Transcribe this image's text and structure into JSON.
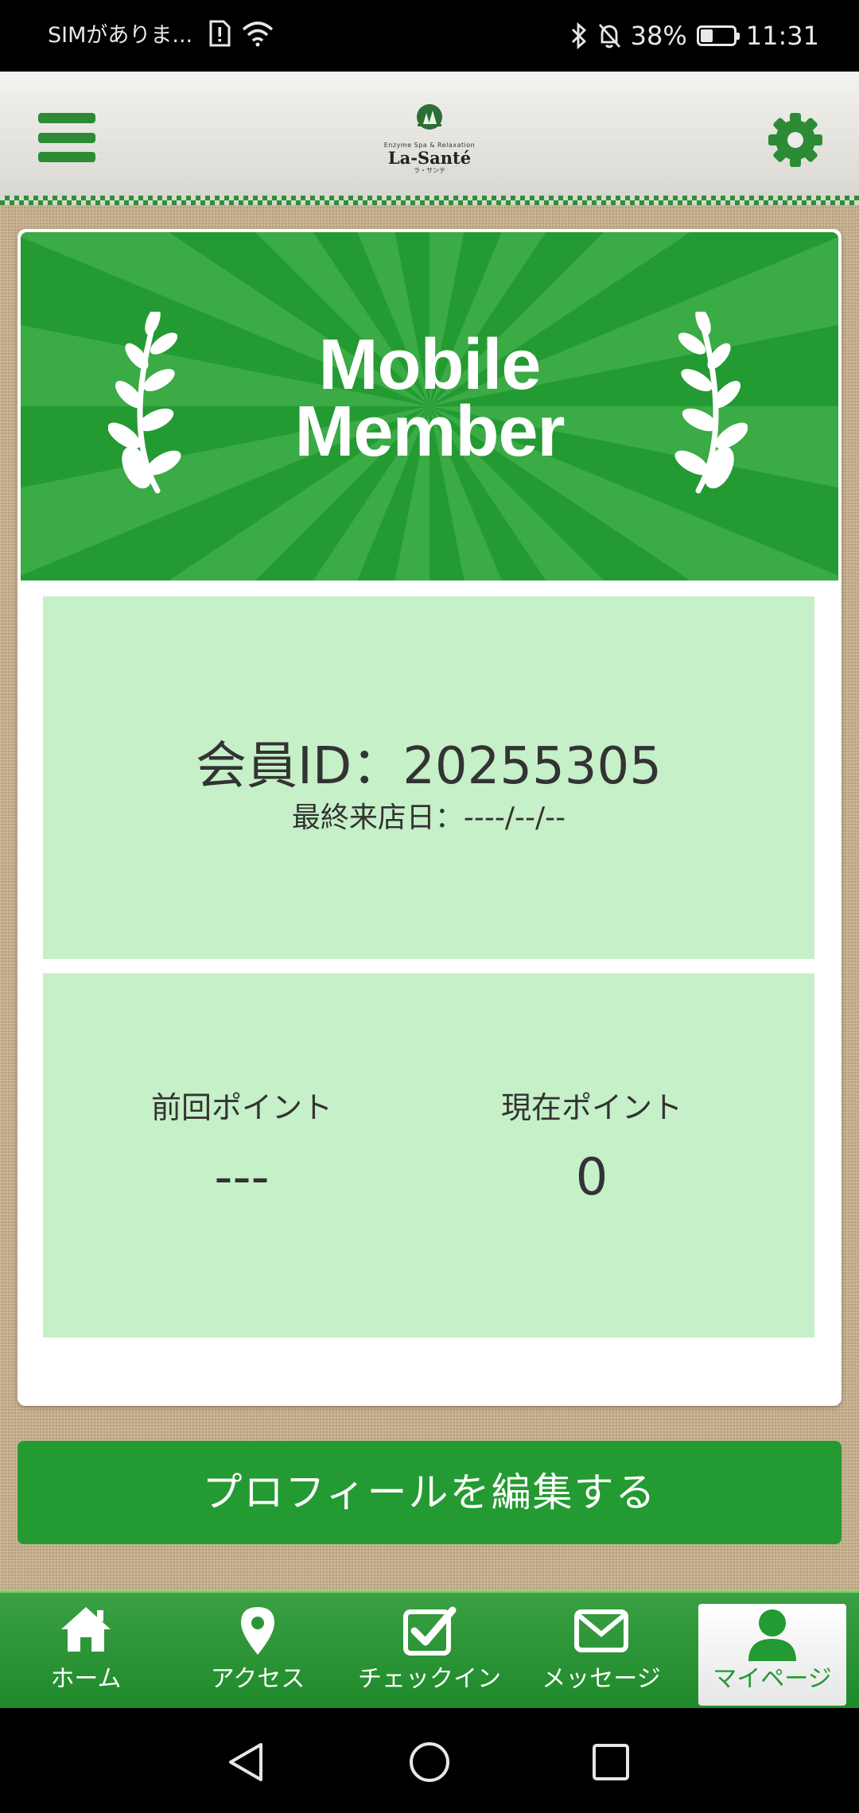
{
  "status_bar": {
    "carrier": "SIMがありま...",
    "battery_percent": "38%",
    "battery_level": 0.38,
    "time": "11:31"
  },
  "header": {
    "logo": {
      "tagline": "Enzyme Spa & Relaxation",
      "name": "La-Santé",
      "kana": "ラ・サンテ"
    },
    "icons": {
      "menu": "hamburger-menu-icon",
      "settings": "gear-icon"
    }
  },
  "banner": {
    "title_line1": "Mobile",
    "title_line2": "Member"
  },
  "member": {
    "id_label": "会員ID：20255305",
    "last_visit_label": "最終来店日：----/--/--"
  },
  "points": {
    "previous_label": "前回ポイント",
    "previous_value": "---",
    "current_label": "現在ポイント",
    "current_value": "0"
  },
  "edit_profile_button": "プロフィールを編集する",
  "tabs": [
    {
      "label": "ホーム",
      "icon": "home-icon"
    },
    {
      "label": "アクセス",
      "icon": "map-pin-icon"
    },
    {
      "label": "チェックイン",
      "icon": "checkbox-icon"
    },
    {
      "label": "メッセージ",
      "icon": "envelope-icon"
    },
    {
      "label": "マイページ",
      "icon": "user-icon",
      "active": true
    }
  ],
  "colors": {
    "brand_green": "#239a32",
    "panel_green": "#c6f0c8",
    "text_dark": "#333333"
  }
}
